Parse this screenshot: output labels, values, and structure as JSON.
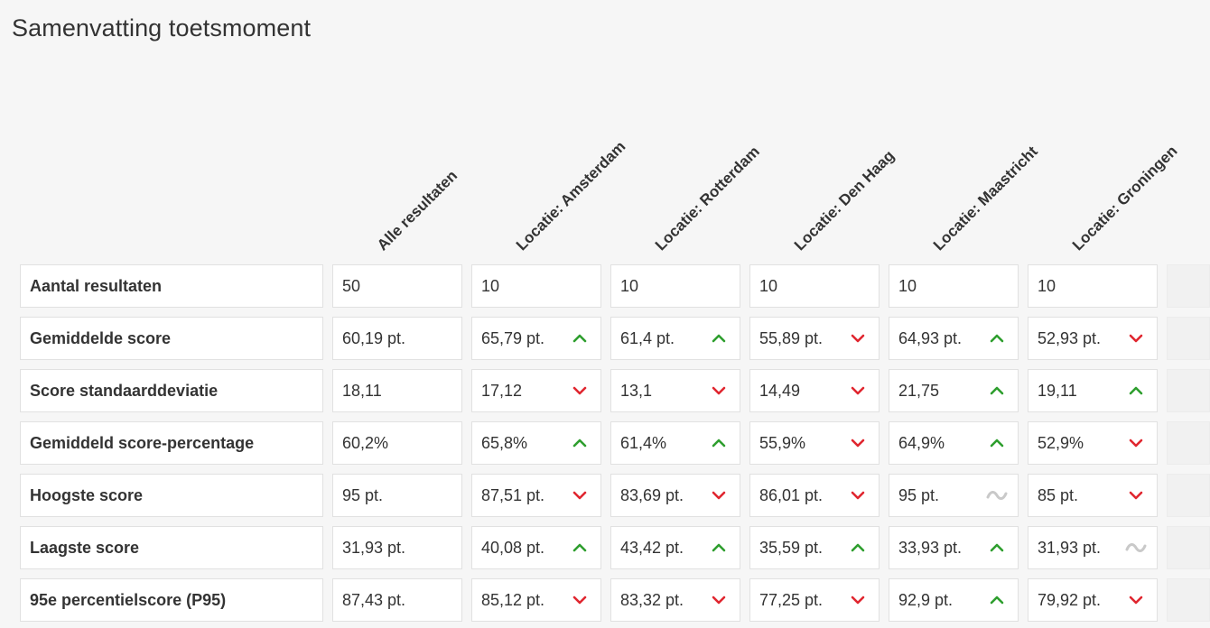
{
  "title": "Samenvatting toetsmoment",
  "colors": {
    "up": "#2e9e2e",
    "down": "#e0262f",
    "neutral": "#c9c9c9"
  },
  "columns": [
    "Alle resultaten",
    "Locatie: Amsterdam",
    "Locatie: Rotterdam",
    "Locatie: Den Haag",
    "Locatie: Maastricht",
    "Locatie: Groningen"
  ],
  "rows": [
    {
      "label": "Aantal resultaten",
      "cells": [
        {
          "value": "50",
          "trend": "none"
        },
        {
          "value": "10",
          "trend": "none"
        },
        {
          "value": "10",
          "trend": "none"
        },
        {
          "value": "10",
          "trend": "none"
        },
        {
          "value": "10",
          "trend": "none"
        },
        {
          "value": "10",
          "trend": "none"
        }
      ]
    },
    {
      "label": "Gemiddelde score",
      "cells": [
        {
          "value": "60,19 pt.",
          "trend": "none"
        },
        {
          "value": "65,79 pt.",
          "trend": "up"
        },
        {
          "value": "61,4 pt.",
          "trend": "up"
        },
        {
          "value": "55,89 pt.",
          "trend": "down"
        },
        {
          "value": "64,93 pt.",
          "trend": "up"
        },
        {
          "value": "52,93 pt.",
          "trend": "down"
        }
      ]
    },
    {
      "label": "Score standaarddeviatie",
      "cells": [
        {
          "value": "18,11",
          "trend": "none"
        },
        {
          "value": "17,12",
          "trend": "down"
        },
        {
          "value": "13,1",
          "trend": "down"
        },
        {
          "value": "14,49",
          "trend": "down"
        },
        {
          "value": "21,75",
          "trend": "up"
        },
        {
          "value": "19,11",
          "trend": "up"
        }
      ]
    },
    {
      "label": "Gemiddeld score-percentage",
      "cells": [
        {
          "value": "60,2%",
          "trend": "none"
        },
        {
          "value": "65,8%",
          "trend": "up"
        },
        {
          "value": "61,4%",
          "trend": "up"
        },
        {
          "value": "55,9%",
          "trend": "down"
        },
        {
          "value": "64,9%",
          "trend": "up"
        },
        {
          "value": "52,9%",
          "trend": "down"
        }
      ]
    },
    {
      "label": "Hoogste score",
      "cells": [
        {
          "value": "95 pt.",
          "trend": "none"
        },
        {
          "value": "87,51 pt.",
          "trend": "down"
        },
        {
          "value": "83,69 pt.",
          "trend": "down"
        },
        {
          "value": "86,01 pt.",
          "trend": "down"
        },
        {
          "value": "95 pt.",
          "trend": "equal"
        },
        {
          "value": "85 pt.",
          "trend": "down"
        }
      ]
    },
    {
      "label": "Laagste score",
      "cells": [
        {
          "value": "31,93 pt.",
          "trend": "none"
        },
        {
          "value": "40,08 pt.",
          "trend": "up"
        },
        {
          "value": "43,42 pt.",
          "trend": "up"
        },
        {
          "value": "35,59 pt.",
          "trend": "up"
        },
        {
          "value": "33,93 pt.",
          "trend": "up"
        },
        {
          "value": "31,93 pt.",
          "trend": "equal"
        }
      ]
    },
    {
      "label": "95e percentielscore (P95)",
      "cells": [
        {
          "value": "87,43 pt.",
          "trend": "none"
        },
        {
          "value": "85,12 pt.",
          "trend": "down"
        },
        {
          "value": "83,32 pt.",
          "trend": "down"
        },
        {
          "value": "77,25 pt.",
          "trend": "down"
        },
        {
          "value": "92,9 pt.",
          "trend": "up"
        },
        {
          "value": "79,92 pt.",
          "trend": "down"
        }
      ]
    }
  ]
}
